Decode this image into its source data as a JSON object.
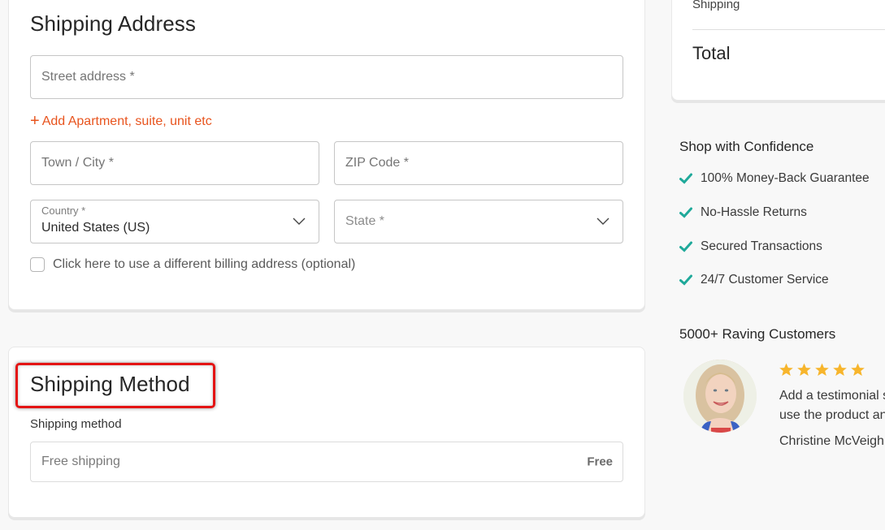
{
  "shipping_address": {
    "title": "Shipping Address",
    "street": {
      "placeholder": "Street address *",
      "value": ""
    },
    "add_apartment_link": "Add Apartment, suite, unit etc",
    "city": {
      "placeholder": "Town / City *",
      "value": ""
    },
    "zip": {
      "placeholder": "ZIP Code *",
      "value": ""
    },
    "country": {
      "label": "Country *",
      "selected": "United States (US)"
    },
    "state": {
      "placeholder": "State *",
      "selected": ""
    },
    "billing_checkbox": {
      "label": "Click here to use a different billing address (optional)",
      "checked": false
    }
  },
  "shipping_method": {
    "title": "Shipping Method",
    "field_label": "Shipping method",
    "option": {
      "name": "Free shipping",
      "price": "Free"
    }
  },
  "order_summary": {
    "shipping_label": "Shipping",
    "total_label": "Total"
  },
  "confidence": {
    "title": "Shop with Confidence",
    "items": [
      {
        "label": "100% Money-Back Guarantee",
        "icon": "check-icon"
      },
      {
        "label": "No-Hassle Returns",
        "icon": "check-icon"
      },
      {
        "label": "Secured Transactions",
        "icon": "check-icon"
      },
      {
        "label": "24/7 Customer Service",
        "icon": "check-icon"
      }
    ]
  },
  "reviews": {
    "title": "5000+ Raving Customers",
    "rating": 5,
    "rating_max": 5,
    "testimonial_line1": "Add a testimonial s",
    "testimonial_line2": "use the product an",
    "customer_name": "Christine McVeigh"
  },
  "colors": {
    "accent_link": "#e8541e",
    "check": "#1fa99a",
    "star": "#f7b52c",
    "highlight": "#e41414"
  }
}
